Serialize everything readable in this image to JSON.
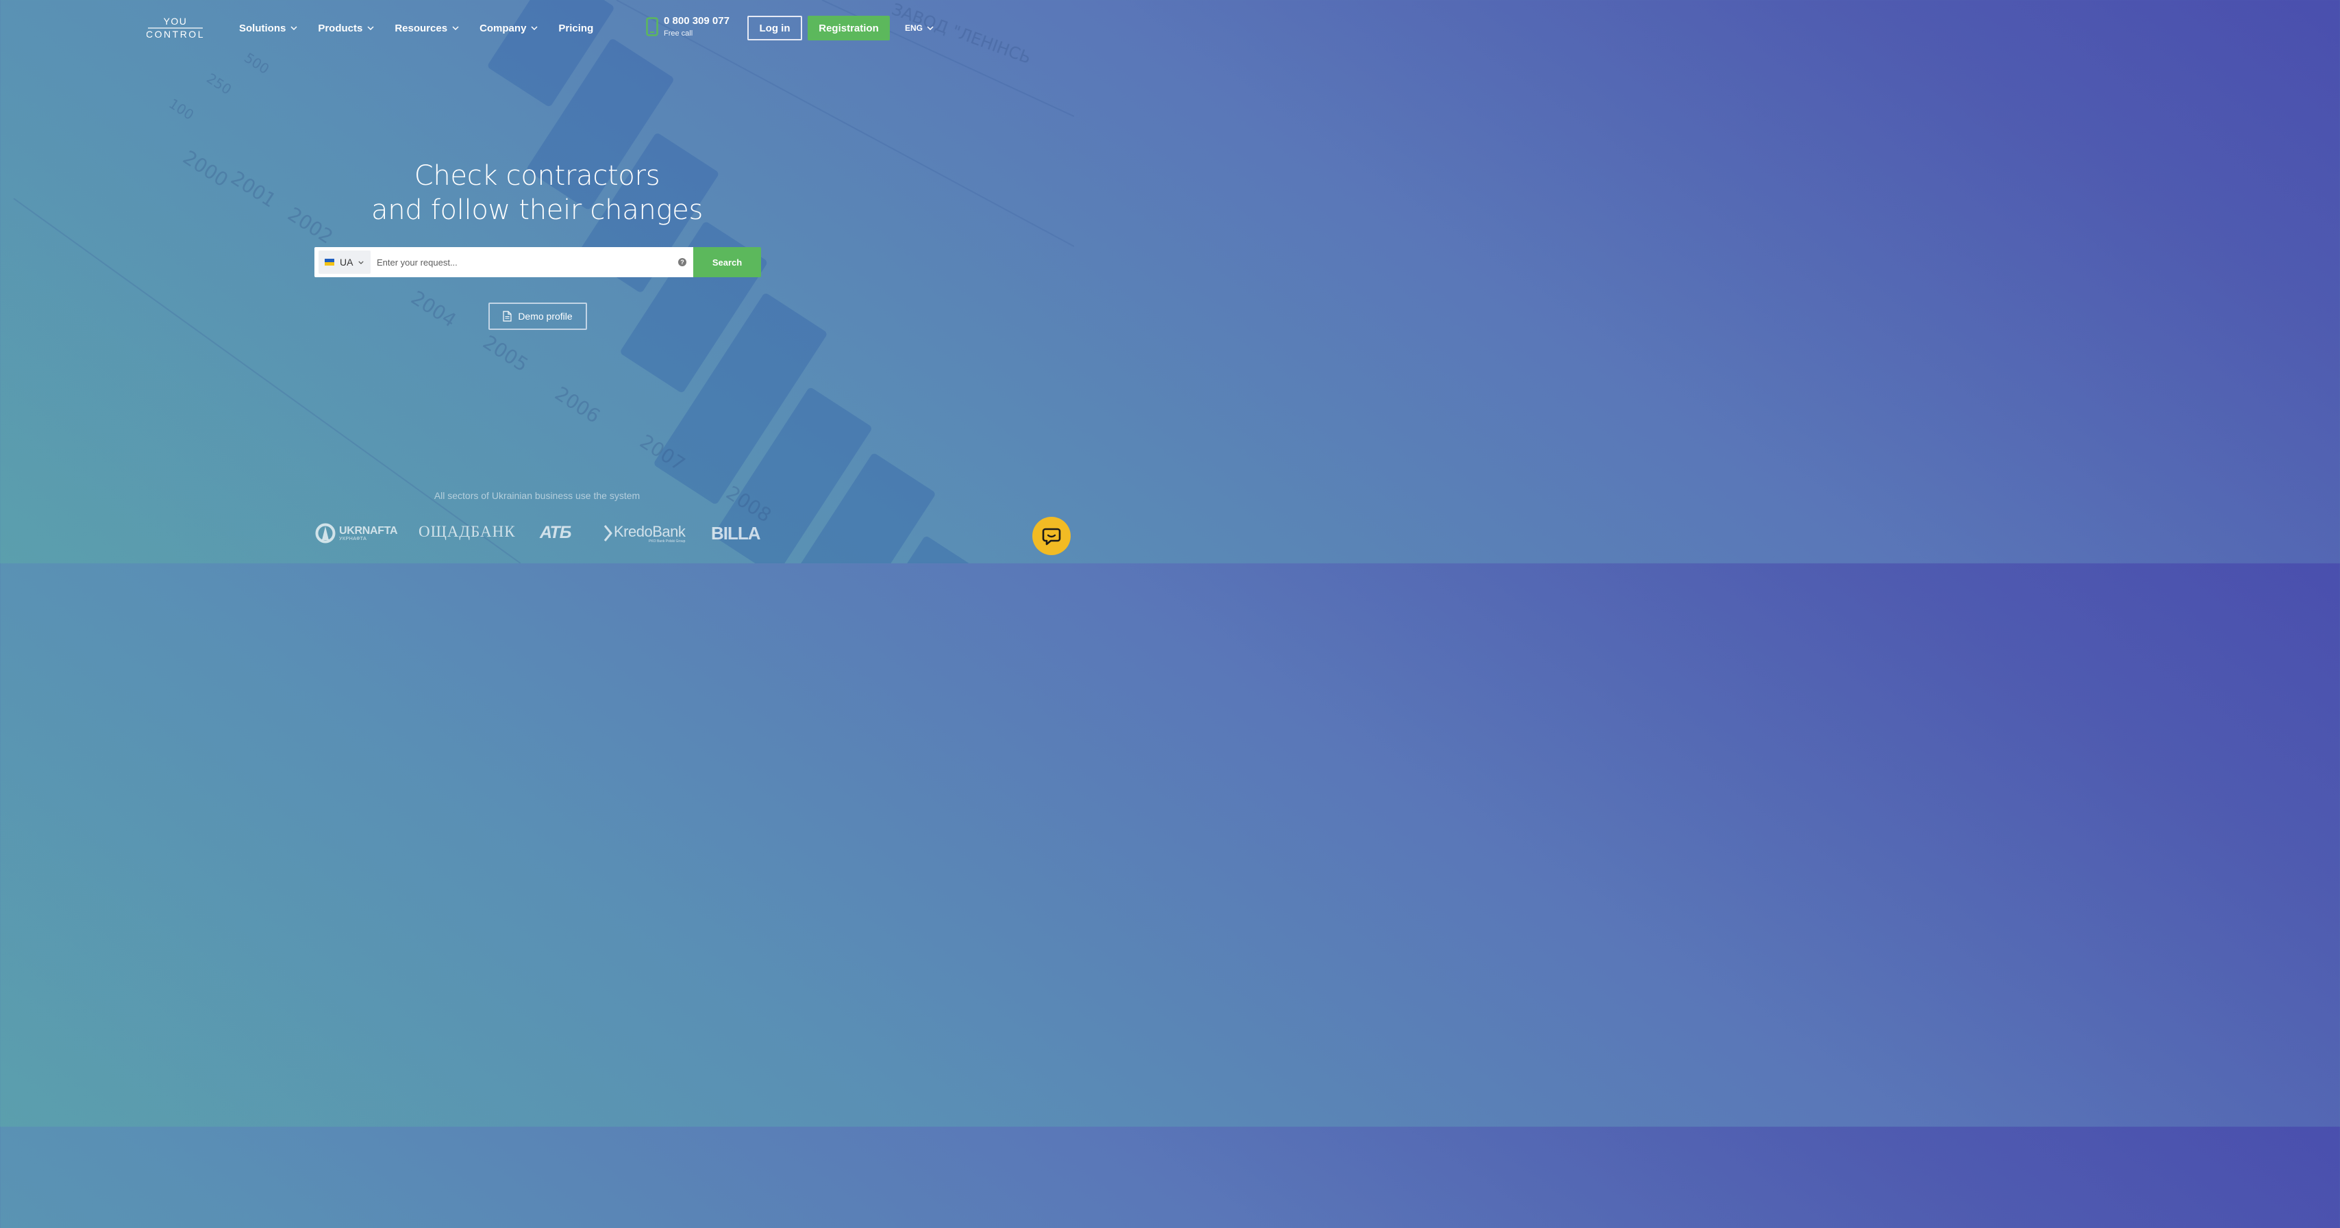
{
  "brand": {
    "logo_top": "YOU",
    "logo_bottom": "CONTROL"
  },
  "nav": {
    "items": [
      {
        "label": "Solutions",
        "has_dropdown": true
      },
      {
        "label": "Products",
        "has_dropdown": true
      },
      {
        "label": "Resources",
        "has_dropdown": true
      },
      {
        "label": "Company",
        "has_dropdown": true
      },
      {
        "label": "Pricing",
        "has_dropdown": false
      }
    ]
  },
  "contact": {
    "phone": "0 800 309 077",
    "phone_note": "Free call",
    "icon": "phone-icon"
  },
  "auth": {
    "login_label": "Log in",
    "register_label": "Registration"
  },
  "language": {
    "current": "ENG"
  },
  "hero": {
    "title_line1": "Check contractors",
    "title_line2": "and follow their changes"
  },
  "search": {
    "country_code": "UA",
    "placeholder": "Enter your request...",
    "value": "",
    "help_symbol": "?",
    "button_label": "Search"
  },
  "demo": {
    "label": "Demo profile",
    "icon": "document-icon"
  },
  "partners": {
    "caption": "All sectors of Ukrainian business use the system",
    "ukrnafta": {
      "name": "UKRNAFTA",
      "subtitle": "УКРНАФТА"
    },
    "oschadbank": "ОЩАДБАНК",
    "atb": "АТБ",
    "kredobank": {
      "name": "KredoBank",
      "subtitle": "PKO Bank Polski Group"
    },
    "billa": "BILLA"
  },
  "colors": {
    "accent_green": "#5cb85c",
    "chat_yellow": "#f2bb24",
    "bg_teal": "#5b9fad",
    "bg_indigo": "#4a4fae"
  }
}
